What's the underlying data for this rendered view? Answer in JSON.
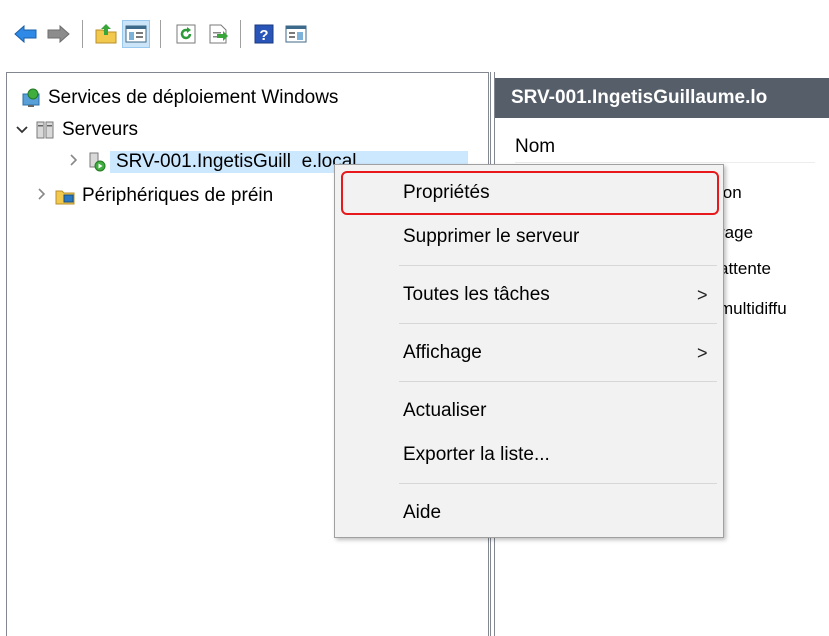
{
  "toolbar": {
    "buttons": [
      "back-arrow-icon",
      "forward-arrow-icon",
      "up-folder-icon",
      "show-hide-tree-icon",
      "refresh-icon",
      "export-list-icon",
      "help-icon",
      "console-tree-icon"
    ]
  },
  "tree": {
    "root": "Services de déploiement Windows",
    "servers": "Serveurs",
    "server_item": "SRV-001.IngetisGuill",
    "server_item_tail": "e.local",
    "devices": "Périphériques de préin"
  },
  "right_pane": {
    "header": "SRV-001.IngetisGuillaume.lo",
    "column": "Nom",
    "rows": [
      "ion",
      "rage",
      "attente",
      "multidiffu"
    ]
  },
  "context_menu": {
    "items": [
      {
        "label": "Propriétés",
        "submenu": false
      },
      {
        "label": "Supprimer le serveur",
        "submenu": false
      },
      {
        "label": "Toutes les tâches",
        "submenu": true
      },
      {
        "label": "Affichage",
        "submenu": true
      },
      {
        "label": "Actualiser",
        "submenu": false
      },
      {
        "label": "Exporter la liste...",
        "submenu": false
      },
      {
        "label": "Aide",
        "submenu": false
      }
    ],
    "arrow_glyph": ">",
    "highlight_color": "#e8191c"
  }
}
